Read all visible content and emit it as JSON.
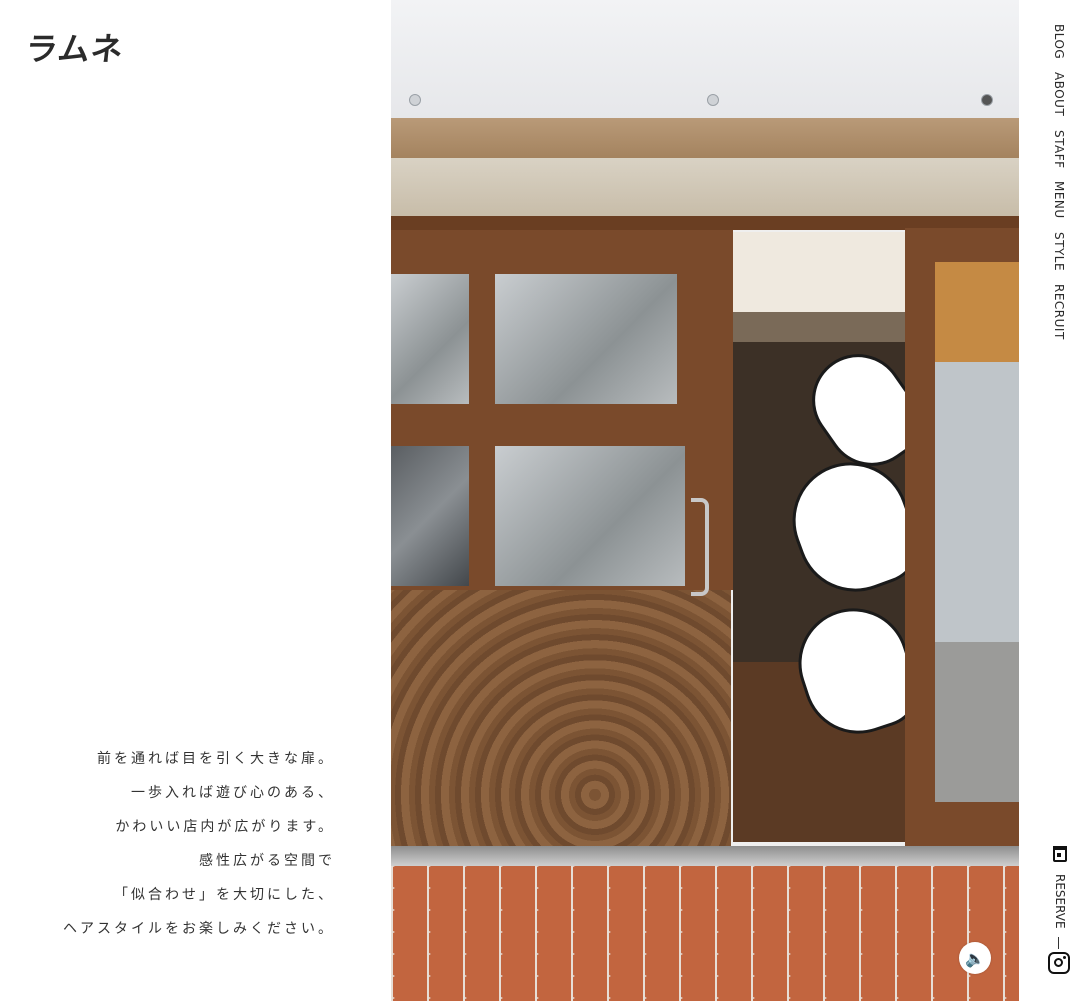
{
  "brand": {
    "logo_text": "ラムネ"
  },
  "tagline": [
    "前を通れば目を引く大きな扉。",
    "一歩入れば遊び心のある、",
    "かわいい店内が広がります。",
    "感性広がる空間で",
    "「似合わせ」を大切にした、",
    "ヘアスタイルをお楽しみください。"
  ],
  "nav": {
    "items": [
      "BLOG",
      "ABOUT",
      "STAFF",
      "MENU",
      "STYLE",
      "RECRUIT"
    ],
    "reserve_label": "RESERVE"
  },
  "hero": {
    "sound_icon": "speaker-icon"
  },
  "icons": {
    "reserve": "calendar-icon",
    "social": "instagram-icon"
  }
}
